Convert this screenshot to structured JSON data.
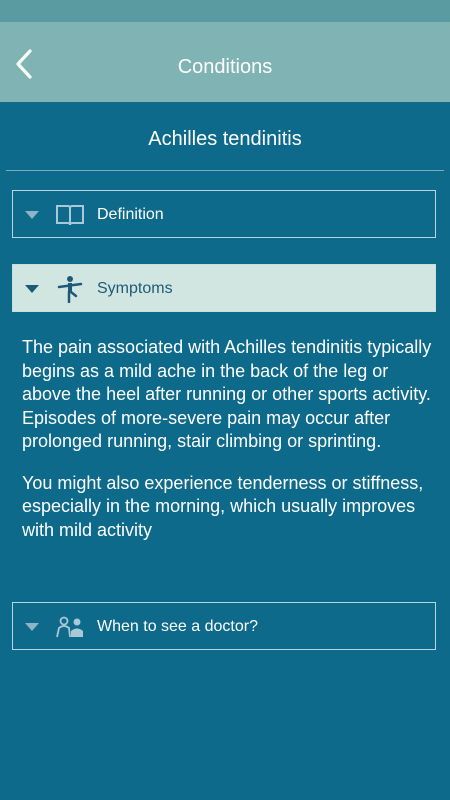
{
  "header": {
    "title": "Conditions",
    "back_icon": "chevron-left-icon"
  },
  "page": {
    "title": "Achilles tendinitis"
  },
  "sections": [
    {
      "label": "Definition",
      "icon": "book-icon",
      "expanded": false
    },
    {
      "label": "Symptoms",
      "icon": "person-balance-icon",
      "expanded": true,
      "paragraphs": [
        "The pain associated with Achilles tendinitis typically begins as a mild ache in the back of the leg or above the heel after running or other sports activity. Episodes of more-severe pain may occur after prolonged running, stair climbing or sprinting.",
        "You might also experience tenderness or stiffness, especially in the morning, which usually improves with mild activity"
      ]
    },
    {
      "label": "When to see a doctor?",
      "icon": "patient-doctor-icon",
      "expanded": false
    }
  ],
  "colors": {
    "background": "#0d6a8a",
    "app_bar": "#7fb3b4",
    "status_bar": "#5a9aa1",
    "expanded_header": "#d2e6e1",
    "expanded_text": "#1e5a78"
  }
}
